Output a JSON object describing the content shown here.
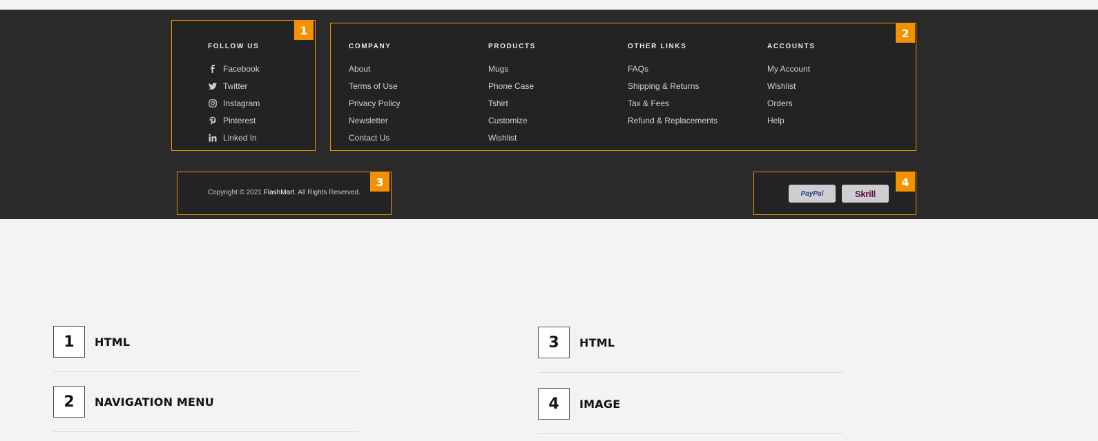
{
  "footer": {
    "follow": {
      "badge": "1",
      "title": "FOLLOW US",
      "items": [
        {
          "label": "Facebook",
          "icon": "facebook-icon"
        },
        {
          "label": "Twitter",
          "icon": "twitter-icon"
        },
        {
          "label": "Instagram",
          "icon": "instagram-icon"
        },
        {
          "label": "Pinterest",
          "icon": "pinterest-icon"
        },
        {
          "label": "Linked In",
          "icon": "linkedin-icon"
        }
      ]
    },
    "nav": {
      "badge": "2",
      "columns": [
        {
          "title": "COMPANY",
          "links": [
            "About",
            "Terms of Use",
            "Privacy Policy",
            "Newsletter",
            "Contact Us"
          ]
        },
        {
          "title": "PRODUCTS",
          "links": [
            "Mugs",
            "Phone Case",
            "Tshirt",
            "Customize",
            "Wishlist"
          ]
        },
        {
          "title": "OTHER LINKS",
          "links": [
            "FAQs",
            "Shipping & Returns",
            "Tax & Fees",
            "Refund & Replacements"
          ]
        },
        {
          "title": "ACCOUNTS",
          "links": [
            "My Account",
            "Wishlist",
            "Orders",
            "Help"
          ]
        }
      ]
    },
    "copyright": {
      "badge": "3",
      "prefix": "Copyright © 2021 ",
      "brand": "FlashMart",
      "suffix": ". All Rights Reserved."
    },
    "payments": {
      "badge": "4",
      "methods": [
        "PayPal",
        "Skrill"
      ]
    }
  },
  "legend": [
    {
      "number": "1",
      "label": "HTML"
    },
    {
      "number": "2",
      "label": "NAVIGATION MENU"
    },
    {
      "number": "3",
      "label": "HTML"
    },
    {
      "number": "4",
      "label": "IMAGE"
    }
  ],
  "colors": {
    "accent": "#f39200",
    "footer_bg": "#2a2a2a",
    "page_bg": "#f3f3f3"
  }
}
